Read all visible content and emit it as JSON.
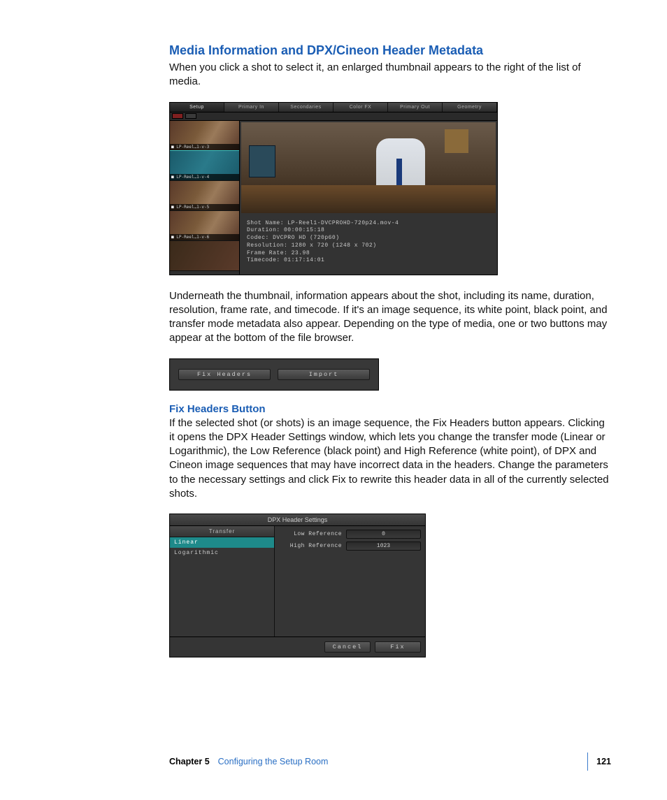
{
  "heading": "Media Information and DPX/Cineon Header Metadata",
  "intro": "When you click a shot to select it, an enlarged thumbnail appears to the right of the list of media.",
  "shot1": {
    "tabs": [
      "Setup",
      "Primary In",
      "Secondaries",
      "Color FX",
      "Primary Out",
      "Geometry"
    ],
    "clips": [
      "LP-Reel…1-v-3",
      "LP-Reel…1-v-4",
      "LP-Reel…1-v-5",
      "LP-Reel…1-v-6",
      ""
    ],
    "meta": "Shot Name: LP-Reel1-DVCPROHD-720p24.mov-4\nDuration: 00:00:15:18\nCodec: DVCPRO HD (720p60)\nResolution: 1280 x 720 (1248 x 702)\nFrame Rate: 23.98\nTimecode: 01:17:14:01"
  },
  "para2": "Underneath the thumbnail, information appears about the shot, including its name, duration, resolution, frame rate, and timecode. If it's an image sequence, its white point, black point, and transfer mode metadata also appear. Depending on the type of media, one or two buttons may appear at the bottom of the file browser.",
  "shot2": {
    "btn1": "Fix Headers",
    "btn2": "Import"
  },
  "subhead": "Fix Headers Button",
  "para3": "If the selected shot (or shots) is an image sequence, the Fix Headers button appears. Clicking it opens the DPX Header Settings window, which lets you change the transfer mode (Linear or Logarithmic), the Low Reference (black point) and High Reference (white point), of DPX and Cineon image sequences that may have incorrect data in the headers. Change the parameters to the necessary settings and click Fix to rewrite this header data in all of the currently selected shots.",
  "shot3": {
    "title": "DPX Header Settings",
    "transfer_head": "Transfer",
    "opts": [
      "Linear",
      "Logarithmic"
    ],
    "low_label": "Low Reference",
    "low_val": "0",
    "high_label": "High Reference",
    "high_val": "1023",
    "cancel": "Cancel",
    "fix": "Fix"
  },
  "footer": {
    "chapter": "Chapter 5",
    "title": "Configuring the Setup Room",
    "page": "121"
  }
}
